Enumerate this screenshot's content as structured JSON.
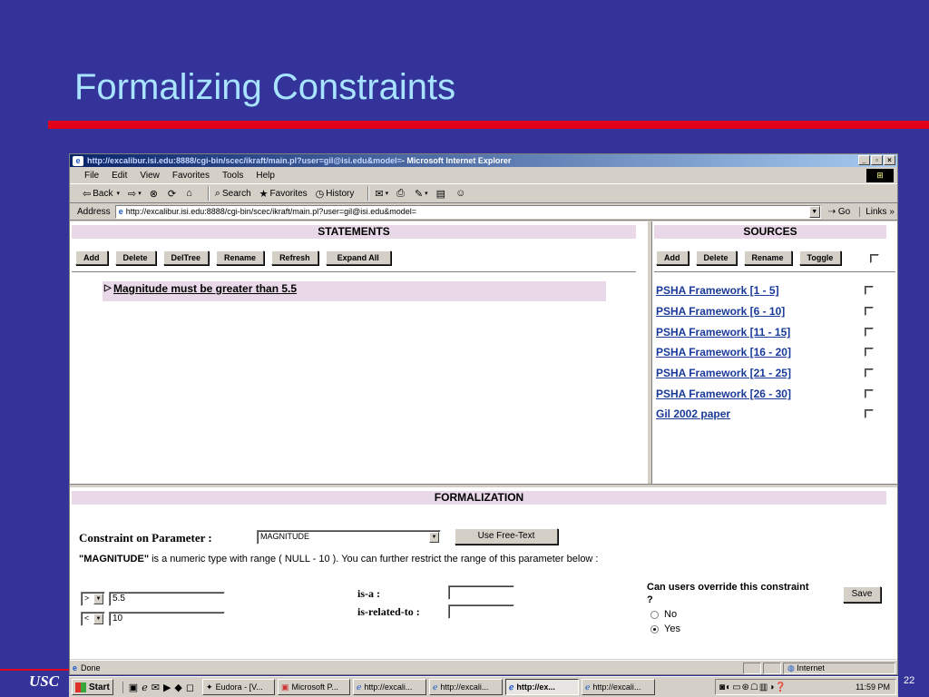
{
  "slide": {
    "title": "Formalizing Constraints",
    "footer_logo": "USC",
    "page_number": "22"
  },
  "browser": {
    "title_url": "http://excalibur.isi.edu:8888/cgi-bin/scec/ikraft/main.pl?user=gil@isi.edu&model=",
    "title_app": " - Microsoft Internet Explorer",
    "menu": [
      "File",
      "Edit",
      "View",
      "Favorites",
      "Tools",
      "Help"
    ],
    "toolbar": {
      "back": "Back",
      "search": "Search",
      "favorites": "Favorites",
      "history": "History"
    },
    "address_label": "Address",
    "address_value": "http://excalibur.isi.edu:8888/cgi-bin/scec/ikraft/main.pl?user=gil@isi.edu&model=",
    "go_label": "Go",
    "links_label": "Links »",
    "status_text": "Done",
    "zone_text": "Internet"
  },
  "statements": {
    "header": "STATEMENTS",
    "buttons": [
      "Add",
      "Delete",
      "DelTree",
      "Rename",
      "Refresh",
      "Expand All"
    ],
    "items": [
      "Magnitude must be greater than 5.5"
    ]
  },
  "sources": {
    "header": "SOURCES",
    "buttons": [
      "Add",
      "Delete",
      "Rename",
      "Toggle"
    ],
    "items": [
      "PSHA Framework [1 - 5]",
      "PSHA Framework [6 - 10]",
      "PSHA Framework [11 - 15]",
      "PSHA Framework [16 - 20]",
      "PSHA Framework [21 - 25]",
      "PSHA Framework [26 - 30]",
      "Gil 2002 paper"
    ]
  },
  "formalization": {
    "header": "FORMALIZATION",
    "param_label": "Constraint on Parameter :",
    "param_value": "MAGNITUDE",
    "free_text_button": "Use Free-Text",
    "desc_bold": "\"MAGNITUDE\"",
    "desc_rest": " is a numeric type with range ( NULL - 10 ). You can further restrict the range of this parameter below :",
    "op1": ">",
    "val1": "5.5",
    "op2": "<",
    "val2": "10",
    "is_a_label": "is-a :",
    "is_related_label": "is-related-to :",
    "override_question": "Can users override this constraint ?",
    "option_no": "No",
    "option_yes": "Yes",
    "save_button": "Save"
  },
  "taskbar": {
    "start": "Start",
    "tasks": [
      "Eudora - [V...",
      "Microsoft P...",
      "http://excali...",
      "http://excali...",
      "http://ex...",
      "http://excali..."
    ],
    "clock": "11:59 PM"
  }
}
